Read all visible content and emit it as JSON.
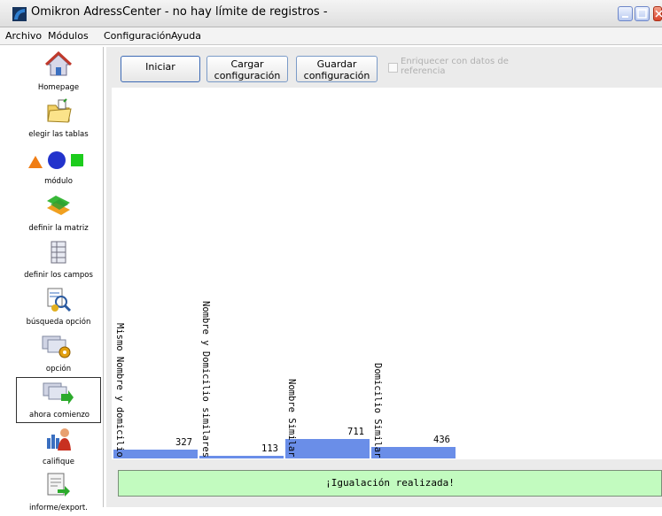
{
  "window": {
    "title": "Omikron AdressCenter - no hay límite de registros -"
  },
  "menu": [
    "Archivo",
    "Módulos",
    "Configuración",
    "Ayuda"
  ],
  "sidebar": {
    "items": [
      {
        "label": "Homepage",
        "icon": "house-icon"
      },
      {
        "label": "elegir las tablas",
        "icon": "folder-icon"
      },
      {
        "label": "módulo",
        "icon": "shapes-icon"
      },
      {
        "label": "definir la matriz",
        "icon": "matrix-icon"
      },
      {
        "label": "definir los campos",
        "icon": "fields-icon"
      },
      {
        "label": "búsqueda opción",
        "icon": "search-option-icon"
      },
      {
        "label": "opción",
        "icon": "option-gear-icon"
      },
      {
        "label": "ahora comienzo",
        "icon": "start-now-icon",
        "active": true
      },
      {
        "label": "califique",
        "icon": "rate-person-icon"
      },
      {
        "label": "informe/export.",
        "icon": "report-export-icon"
      }
    ]
  },
  "toolbar": {
    "start": "Iniciar",
    "load_config_line1": "Cargar",
    "load_config_line2": "configuración",
    "save_config_line1": "Guardar",
    "save_config_line2": "configuración",
    "enrich_label_line1": "Enriquecer con datos de",
    "enrich_label_line2": "referencia",
    "enrich_checked": false
  },
  "chart_data": {
    "type": "bar",
    "categories": [
      "Mismo Nombre y domicilio",
      "Nombre y Domicilio similares",
      "Nombre Similar",
      "Domicilio Similar"
    ],
    "values": [
      327,
      113,
      711,
      436
    ],
    "ylim": [
      0,
      711
    ],
    "bar_color": "#6a8ee8"
  },
  "status": {
    "message": "¡Igualación realizada!",
    "color": "#c2fbbf"
  }
}
